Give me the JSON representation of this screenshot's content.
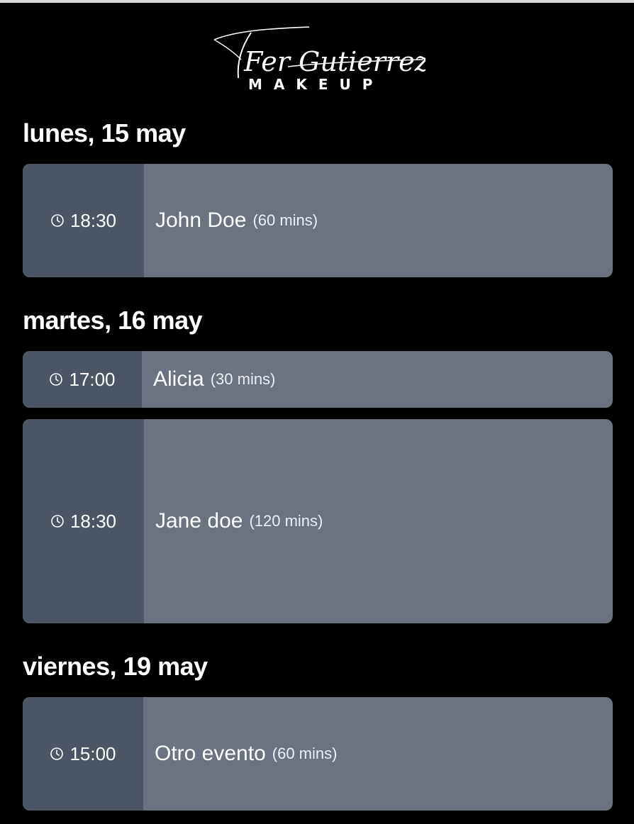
{
  "brand": {
    "script_name": "Fer Gutierrez",
    "tagline": "MAKEUP"
  },
  "days": [
    {
      "heading": "lunes, 15 may",
      "events": [
        {
          "time": "18:30",
          "name": "John Doe",
          "duration": "(60 mins)"
        }
      ]
    },
    {
      "heading": "martes, 16 may",
      "events": [
        {
          "time": "17:00",
          "name": "Alicia",
          "duration": "(30 mins)"
        },
        {
          "time": "18:30",
          "name": "Jane doe",
          "duration": "(120 mins)"
        }
      ]
    },
    {
      "heading": "viernes, 19 may",
      "events": [
        {
          "time": "15:00",
          "name": "Otro evento",
          "duration": "(60 mins)"
        }
      ]
    }
  ],
  "colors": {
    "background": "#000000",
    "card": "#6b7280",
    "time_column": "#4b5563",
    "text": "#ffffff"
  },
  "icons": {
    "event_time": "clock-icon"
  }
}
